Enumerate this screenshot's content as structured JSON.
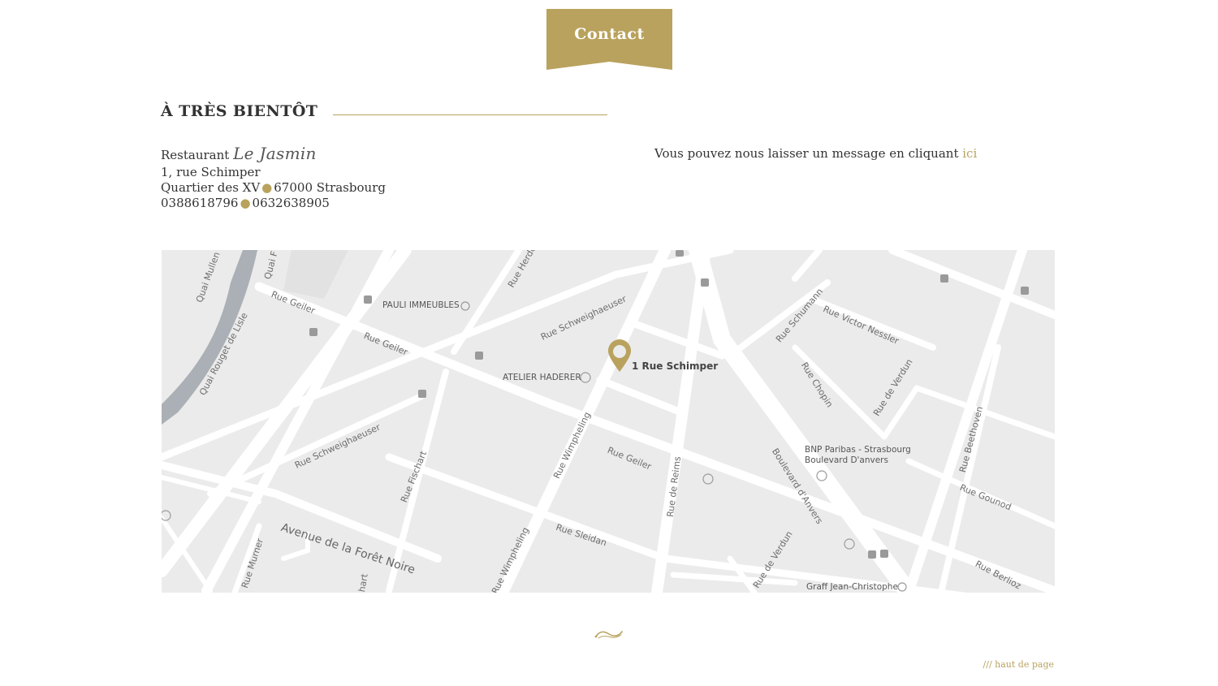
{
  "header": {
    "contact_label": "Contact"
  },
  "section": {
    "title": "À TRÈS BIENTÔT"
  },
  "address": {
    "restaurant_prefix": "Restaurant",
    "restaurant_name": "Le Jasmin",
    "street": "1, rue Schimper",
    "district": "Quartier des XV",
    "postcode_city": "67000 Strasbourg",
    "phone_1": "0388618796",
    "phone_2": "0632638905",
    "separator": "●"
  },
  "message": {
    "text": "Vous pouvez nous laisser un message en cliquant",
    "link_label": "ici"
  },
  "map": {
    "pin_label": "1 Rue Schimper",
    "streets": {
      "quai_mullen": "Quai Mullen",
      "quai_f": "Quai F",
      "rue_geiler_1": "Rue Geiler",
      "rue_geiler_2": "Rue Geiler",
      "rue_geiler_3": "Rue Geiler",
      "quai_rouget": "Quai Rouget de Lisle",
      "rue_herder": "Rue Herde",
      "rue_schweighaeuser_1": "Rue Schweighaeuser",
      "rue_schweighaeuser_2": "Rue Schweighaeuser",
      "rue_fischart": "Rue Fischart",
      "rue_wimpheling_1": "Rue Wimpheling",
      "rue_wimpheling_2": "Rue Wimpheling",
      "rue_sleidan": "Rue Sleidan",
      "rue_de_reims": "Rue de Reims",
      "rue_schumann": "Rue Schumann",
      "rue_victor_nessler": "Rue Victor Nessler",
      "rue_chopin": "Rue Chopin",
      "rue_de_verdun_1": "Rue de Verdun",
      "rue_de_verdun_2": "Rue de Verdun",
      "boulevard_anvers": "Boulevard d'Anvers",
      "rue_beethoven": "Rue Beethoven",
      "rue_gounod": "Rue Gounod",
      "rue_berlioz": "Rue Berlioz",
      "rue_murner": "Rue Murner",
      "avenue_foret_noire": "Avenue de la Forêt Noire",
      "hart": "hart"
    },
    "pois": {
      "pauli": "PAULI IMMEUBLES",
      "haderer": "ATELIER HADERER",
      "bnp_1": "BNP Paribas - Strasbourg",
      "bnp_2": "Boulevard D'anvers",
      "graff": "Graff Jean-Christophe"
    }
  },
  "footer": {
    "back_to_top": "/// haut de page"
  },
  "colors": {
    "gold": "#b9a25d",
    "text": "#333333",
    "map_bg": "#ebebeb",
    "road": "#ffffff",
    "water": "#aab0b5"
  },
  "icons": {
    "ornament": "flourish-icon",
    "pin": "map-pin-icon"
  }
}
